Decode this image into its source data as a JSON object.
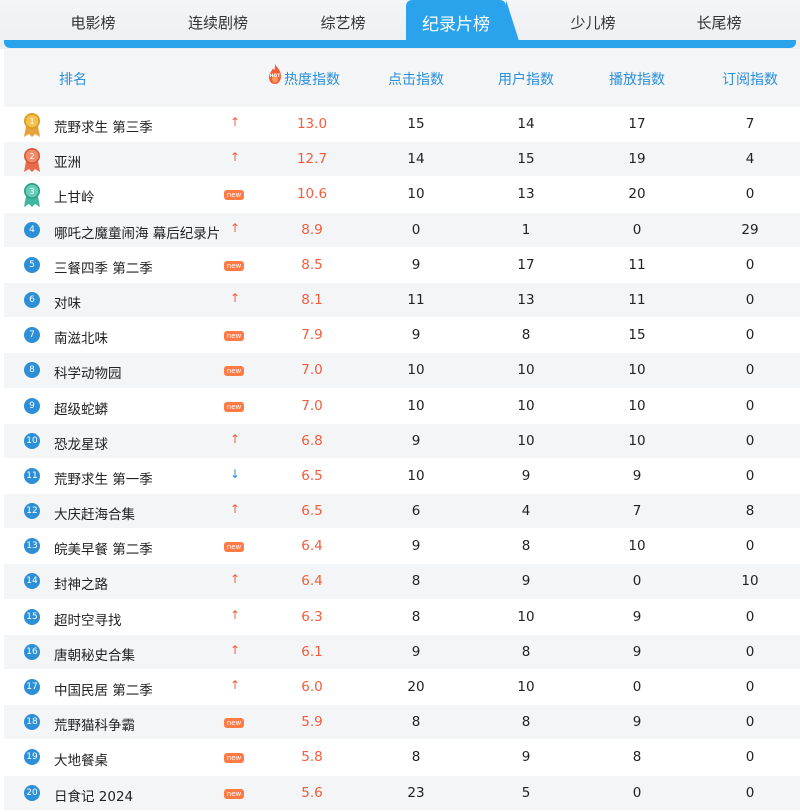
{
  "tabs": [
    {
      "label": "电影榜",
      "active": false
    },
    {
      "label": "连续剧榜",
      "active": false
    },
    {
      "label": "综艺榜",
      "active": false
    },
    {
      "label": "纪录片榜",
      "active": true
    },
    {
      "label": "少儿榜",
      "active": false
    },
    {
      "label": "长尾榜",
      "active": false
    }
  ],
  "header": {
    "rank": "排名",
    "hot_badge": "HOT",
    "heat": "热度指数",
    "click": "点击指数",
    "user": "用户指数",
    "play": "播放指数",
    "subscribe": "订阅指数"
  },
  "colors": {
    "accent": "#2aa3ec",
    "heat": "#f25c3b",
    "rank_badge": "#2d8fd6",
    "new_badge": "#ff7a45"
  },
  "rows": [
    {
      "rank": "1",
      "title": "荒野求生 第三季",
      "trend": "up",
      "heat": "13.0",
      "click": "15",
      "user": "14",
      "play": "17",
      "subscribe": "7"
    },
    {
      "rank": "2",
      "title": "亚洲",
      "trend": "up",
      "heat": "12.7",
      "click": "14",
      "user": "15",
      "play": "19",
      "subscribe": "4"
    },
    {
      "rank": "3",
      "title": "上甘岭",
      "trend": "new",
      "heat": "10.6",
      "click": "10",
      "user": "13",
      "play": "20",
      "subscribe": "0"
    },
    {
      "rank": "4",
      "title": "哪吒之魔童闹海 幕后纪录片",
      "trend": "up",
      "heat": "8.9",
      "click": "0",
      "user": "1",
      "play": "0",
      "subscribe": "29"
    },
    {
      "rank": "5",
      "title": "三餐四季 第二季",
      "trend": "new",
      "heat": "8.5",
      "click": "9",
      "user": "17",
      "play": "11",
      "subscribe": "0"
    },
    {
      "rank": "6",
      "title": "对味",
      "trend": "up",
      "heat": "8.1",
      "click": "11",
      "user": "13",
      "play": "11",
      "subscribe": "0"
    },
    {
      "rank": "7",
      "title": "南滋北味",
      "trend": "new",
      "heat": "7.9",
      "click": "9",
      "user": "8",
      "play": "15",
      "subscribe": "0"
    },
    {
      "rank": "8",
      "title": "科学动物园",
      "trend": "new",
      "heat": "7.0",
      "click": "10",
      "user": "10",
      "play": "10",
      "subscribe": "0"
    },
    {
      "rank": "9",
      "title": "超级蛇蟒",
      "trend": "new",
      "heat": "7.0",
      "click": "10",
      "user": "10",
      "play": "10",
      "subscribe": "0"
    },
    {
      "rank": "10",
      "title": "恐龙星球",
      "trend": "up",
      "heat": "6.8",
      "click": "9",
      "user": "10",
      "play": "10",
      "subscribe": "0"
    },
    {
      "rank": "11",
      "title": "荒野求生 第一季",
      "trend": "down",
      "heat": "6.5",
      "click": "10",
      "user": "9",
      "play": "9",
      "subscribe": "0"
    },
    {
      "rank": "12",
      "title": "大庆赶海合集",
      "trend": "up",
      "heat": "6.5",
      "click": "6",
      "user": "4",
      "play": "7",
      "subscribe": "8"
    },
    {
      "rank": "13",
      "title": "皖美早餐 第二季",
      "trend": "new",
      "heat": "6.4",
      "click": "9",
      "user": "8",
      "play": "10",
      "subscribe": "0"
    },
    {
      "rank": "14",
      "title": "封神之路",
      "trend": "up",
      "heat": "6.4",
      "click": "8",
      "user": "9",
      "play": "0",
      "subscribe": "10"
    },
    {
      "rank": "15",
      "title": "超时空寻找",
      "trend": "up",
      "heat": "6.3",
      "click": "8",
      "user": "10",
      "play": "9",
      "subscribe": "0"
    },
    {
      "rank": "16",
      "title": "唐朝秘史合集",
      "trend": "up",
      "heat": "6.1",
      "click": "9",
      "user": "8",
      "play": "9",
      "subscribe": "0"
    },
    {
      "rank": "17",
      "title": "中国民居 第二季",
      "trend": "up",
      "heat": "6.0",
      "click": "20",
      "user": "10",
      "play": "0",
      "subscribe": "0"
    },
    {
      "rank": "18",
      "title": "荒野猫科争霸",
      "trend": "new",
      "heat": "5.9",
      "click": "8",
      "user": "8",
      "play": "9",
      "subscribe": "0"
    },
    {
      "rank": "19",
      "title": "大地餐桌",
      "trend": "new",
      "heat": "5.8",
      "click": "8",
      "user": "9",
      "play": "8",
      "subscribe": "0"
    },
    {
      "rank": "20",
      "title": "日食记 2024",
      "trend": "new",
      "heat": "5.6",
      "click": "23",
      "user": "5",
      "play": "0",
      "subscribe": "0"
    }
  ],
  "icons": {
    "up": "↑",
    "down": "↓",
    "new": "new"
  }
}
